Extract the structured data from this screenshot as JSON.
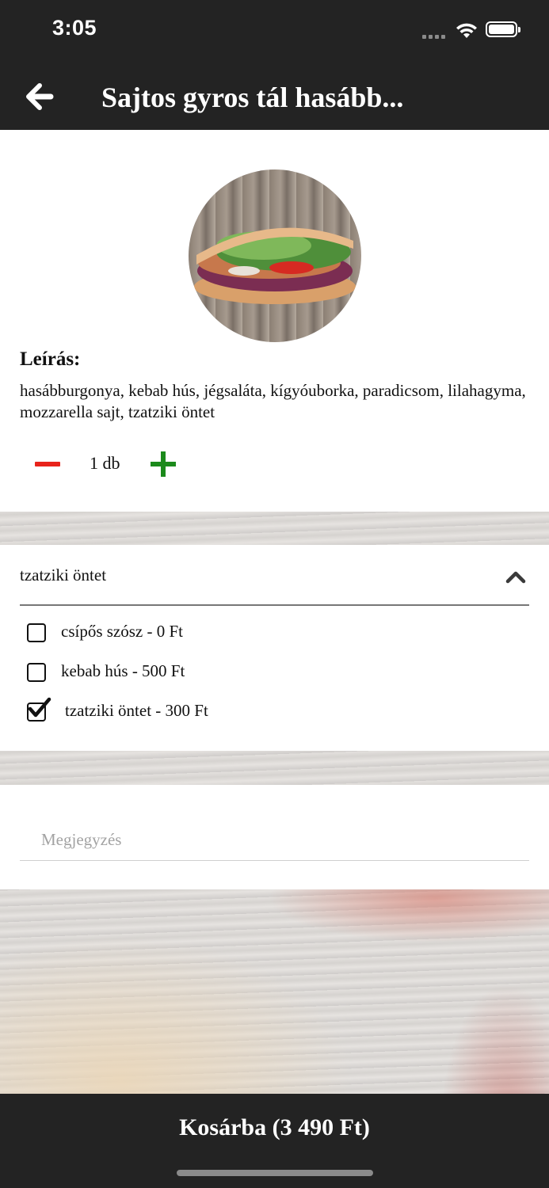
{
  "status_bar": {
    "time": "3:05"
  },
  "header": {
    "title": "Sajtos gyros tál hasább..."
  },
  "product": {
    "description_label": "Leírás:",
    "description": "hasábburgonya, kebab hús, jégsaláta, kígyóuborka, paradicsom, lilahagyma, mozzarella sajt, tzatziki öntet",
    "quantity": "1 db"
  },
  "options": {
    "group_title": "tzatziki öntet",
    "items": [
      {
        "label": "csípős szósz - 0 Ft",
        "checked": false
      },
      {
        "label": "kebab hús - 500 Ft",
        "checked": false
      },
      {
        "label": "tzatziki öntet - 300 Ft",
        "checked": true
      }
    ]
  },
  "note": {
    "placeholder": "Megjegyzés",
    "value": ""
  },
  "cart_button": {
    "label": "Kosárba (3 490 Ft)"
  },
  "colors": {
    "bar_background": "#232323",
    "minus_red": "#e8231b",
    "plus_green": "#1b8a1b"
  },
  "icons": [
    "back-arrow-icon",
    "wifi-icon",
    "battery-icon",
    "chevron-up-icon",
    "minus-icon",
    "plus-icon",
    "checkbox-icon"
  ]
}
